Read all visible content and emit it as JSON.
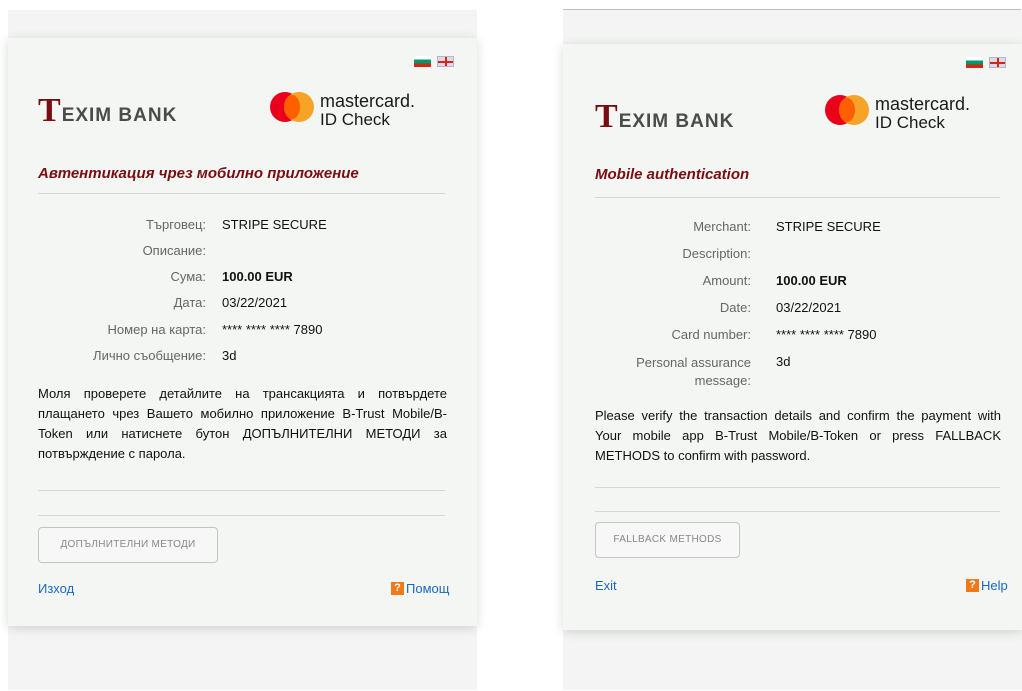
{
  "panels": [
    {
      "language": "bg",
      "title": "Автентикация чрез мобилно приложение",
      "logo": {
        "bank_big": "T",
        "bank_rest": "EXIM BANK",
        "mc_line1": "mastercard.",
        "mc_line2": "ID Check"
      },
      "fields": [
        {
          "label": "Търговец:",
          "value": "STRIPE SECURE"
        },
        {
          "label": "Описание:",
          "value": ""
        },
        {
          "label": "Сума:",
          "value": "100.00 EUR"
        },
        {
          "label": "Дата:",
          "value": "03/22/2021"
        },
        {
          "label": "Номер на карта:",
          "value": "**** **** **** 7890"
        },
        {
          "label": "Лично съобщение:",
          "value": "3d"
        }
      ],
      "message": "Моля проверете детайлите на трансакцията и потвърдете плащането чрез Вашето мобилно приложение B-Trust Mobile/B-Token или натиснете бутон ДОПЪЛНИТЕЛНИ МЕТОДИ за потвърждение с парола.",
      "fallback_button": "ДОПЪЛНИТЕЛНИ МЕТОДИ",
      "exit_link": "Изход",
      "help_icon": "?",
      "help_link": "Помощ"
    },
    {
      "language": "en",
      "title": "Mobile authentication",
      "logo": {
        "bank_big": "T",
        "bank_rest": "EXIM BANK",
        "mc_line1": "mastercard.",
        "mc_line2": "ID Check"
      },
      "fields": [
        {
          "label": "Merchant:",
          "value": "STRIPE SECURE"
        },
        {
          "label": "Description:",
          "value": ""
        },
        {
          "label": "Amount:",
          "value": "100.00 EUR"
        },
        {
          "label": "Date:",
          "value": "03/22/2021"
        },
        {
          "label": "Card number:",
          "value": "**** **** **** 7890"
        },
        {
          "label": "Personal assurance message:",
          "value": "3d"
        }
      ],
      "message": "Please verify the transaction details and confirm the payment with Your mobile app B-Trust Mobile/B-Token or press FALLBACK METHODS to confirm with password.",
      "fallback_button": "FALLBACK METHODS",
      "exit_link": "Exit",
      "help_icon": "?",
      "help_link": "Help"
    }
  ],
  "colors": {
    "brand": "#7a0d12",
    "link": "#1a66c7",
    "help_icon": "#f07a19"
  },
  "icons": [
    "bulgarian-flag-icon",
    "uk-flag-icon",
    "mastercard-logo-icon",
    "help-icon"
  ]
}
